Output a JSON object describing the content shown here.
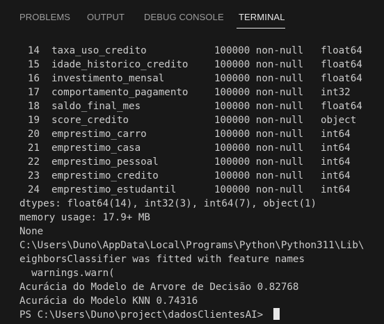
{
  "panel_tabs": [
    "PROBLEMS",
    "OUTPUT",
    "DEBUG CONSOLE",
    "TERMINAL"
  ],
  "active_tab": "TERMINAL",
  "terminal": {
    "rows": [
      {
        "num": "14",
        "name": "taxa_uso_credito",
        "count": "100000 non-null",
        "dtype": "float64"
      },
      {
        "num": "15",
        "name": "idade_historico_credito",
        "count": "100000 non-null",
        "dtype": "float64"
      },
      {
        "num": "16",
        "name": "investimento_mensal",
        "count": "100000 non-null",
        "dtype": "float64"
      },
      {
        "num": "17",
        "name": "comportamento_pagamento",
        "count": "100000 non-null",
        "dtype": "int32"
      },
      {
        "num": "18",
        "name": "saldo_final_mes",
        "count": "100000 non-null",
        "dtype": "float64"
      },
      {
        "num": "19",
        "name": "score_credito",
        "count": "100000 non-null",
        "dtype": "object"
      },
      {
        "num": "20",
        "name": "emprestimo_carro",
        "count": "100000 non-null",
        "dtype": "int64"
      },
      {
        "num": "21",
        "name": "emprestimo_casa",
        "count": "100000 non-null",
        "dtype": "int64"
      },
      {
        "num": "22",
        "name": "emprestimo_pessoal",
        "count": "100000 non-null",
        "dtype": "int64"
      },
      {
        "num": "23",
        "name": "emprestimo_credito",
        "count": "100000 non-null",
        "dtype": "int64"
      },
      {
        "num": "24",
        "name": "emprestimo_estudantil",
        "count": "100000 non-null",
        "dtype": "int64"
      }
    ],
    "dtypes_line": "dtypes: float64(14), int32(3), int64(7), object(1)",
    "memory_line": "memory usage: 17.9+ MB",
    "none_line": "None",
    "path_line": "C:\\Users\\Duno\\AppData\\Local\\Programs\\Python\\Python311\\Lib\\",
    "warning_line": "eighborsClassifier was fitted with feature names",
    "warn_call_line": "  warnings.warn(",
    "accuracy_tree": "Acurácia do Modelo de Arvore de Decisão 0.82768",
    "accuracy_knn": "Acurácia do Modelo KNN 0.74316",
    "prompt": "PS C:\\Users\\Duno\\project\\dadosClientesAI> "
  },
  "colors": {
    "background": "#181818",
    "text": "#cccccc",
    "active_tab": "#e7e7e7",
    "inactive_tab": "#9d9d9d"
  }
}
